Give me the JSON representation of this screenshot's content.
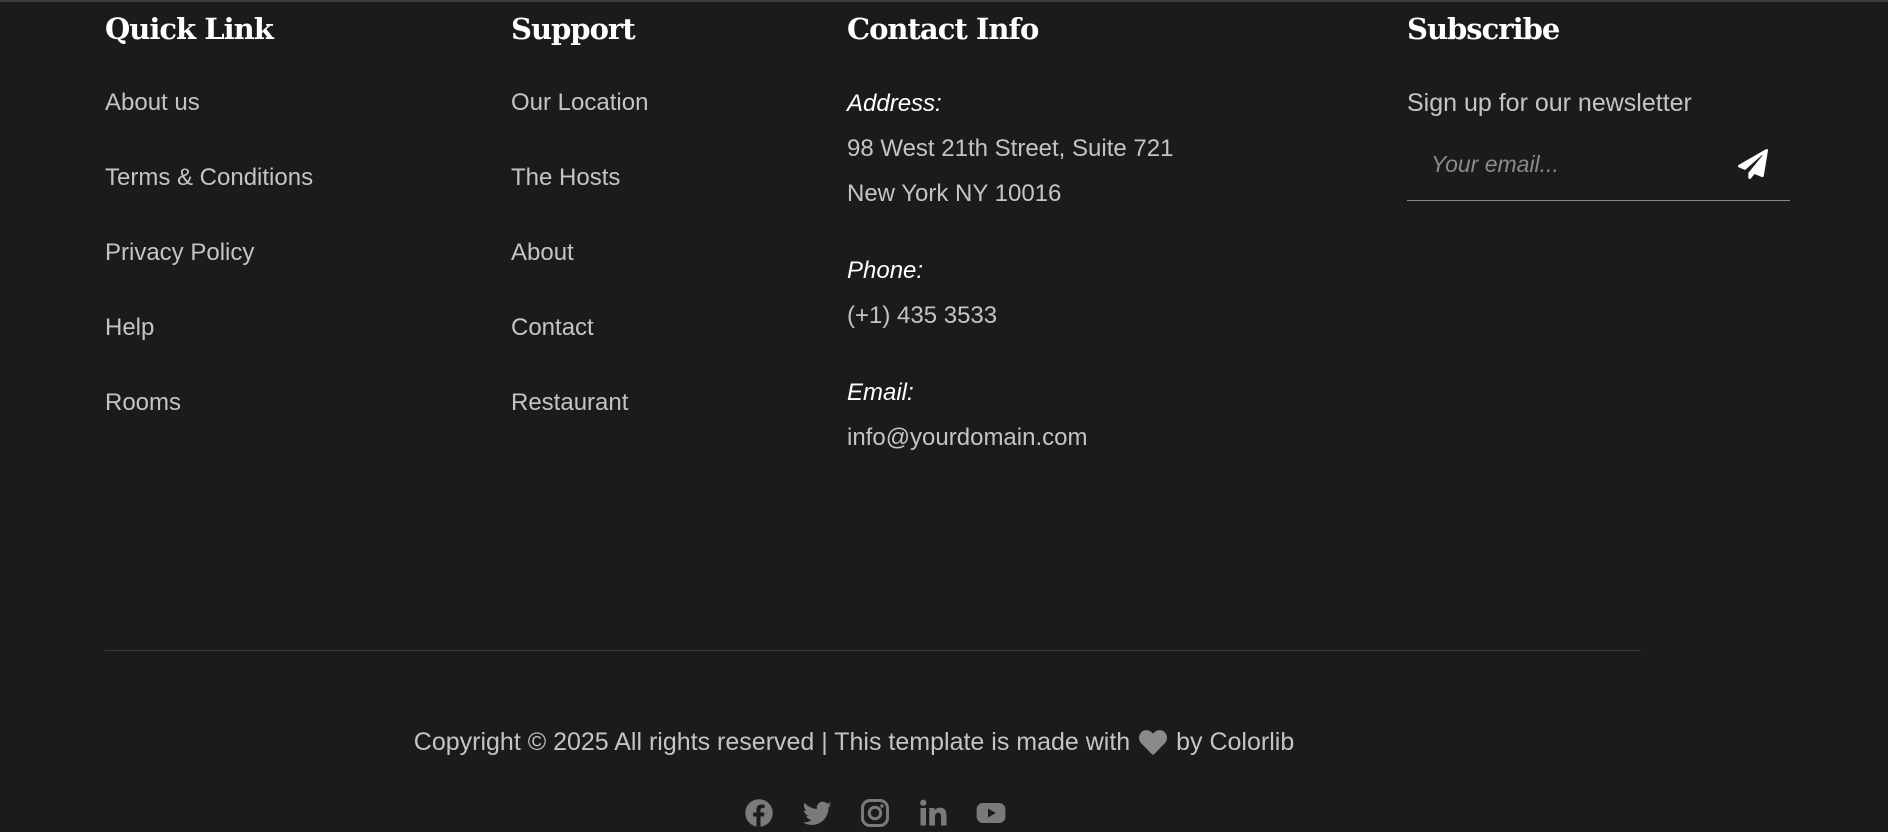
{
  "quick_link": {
    "heading": "Quick Link",
    "items": [
      "About us",
      "Terms & Conditions",
      "Privacy Policy",
      "Help",
      "Rooms"
    ]
  },
  "support": {
    "heading": "Support",
    "items": [
      "Our Location",
      "The Hosts",
      "About",
      "Contact",
      "Restaurant"
    ]
  },
  "contact": {
    "heading": "Contact Info",
    "address_label": "Address:",
    "address_line1": "98 West 21th Street, Suite 721",
    "address_line2": "New York NY 10016",
    "phone_label": "Phone:",
    "phone": "(+1) 435 3533",
    "email_label": "Email:",
    "email": "info@yourdomain.com"
  },
  "subscribe": {
    "heading": "Subscribe",
    "text": "Sign up for our newsletter",
    "email_placeholder": "Your email..."
  },
  "footer": {
    "copyright_before": "Copyright © 2025 All rights reserved | This template is made with",
    "copyright_after": "by Colorlib"
  },
  "social": [
    "facebook-icon",
    "twitter-icon",
    "instagram-icon",
    "linkedin-icon",
    "youtube-icon"
  ],
  "colors": {
    "background": "#1b1b1b",
    "heading": "#ffffff",
    "text": "#c4c4c4",
    "icon": "#7a7a7a"
  }
}
